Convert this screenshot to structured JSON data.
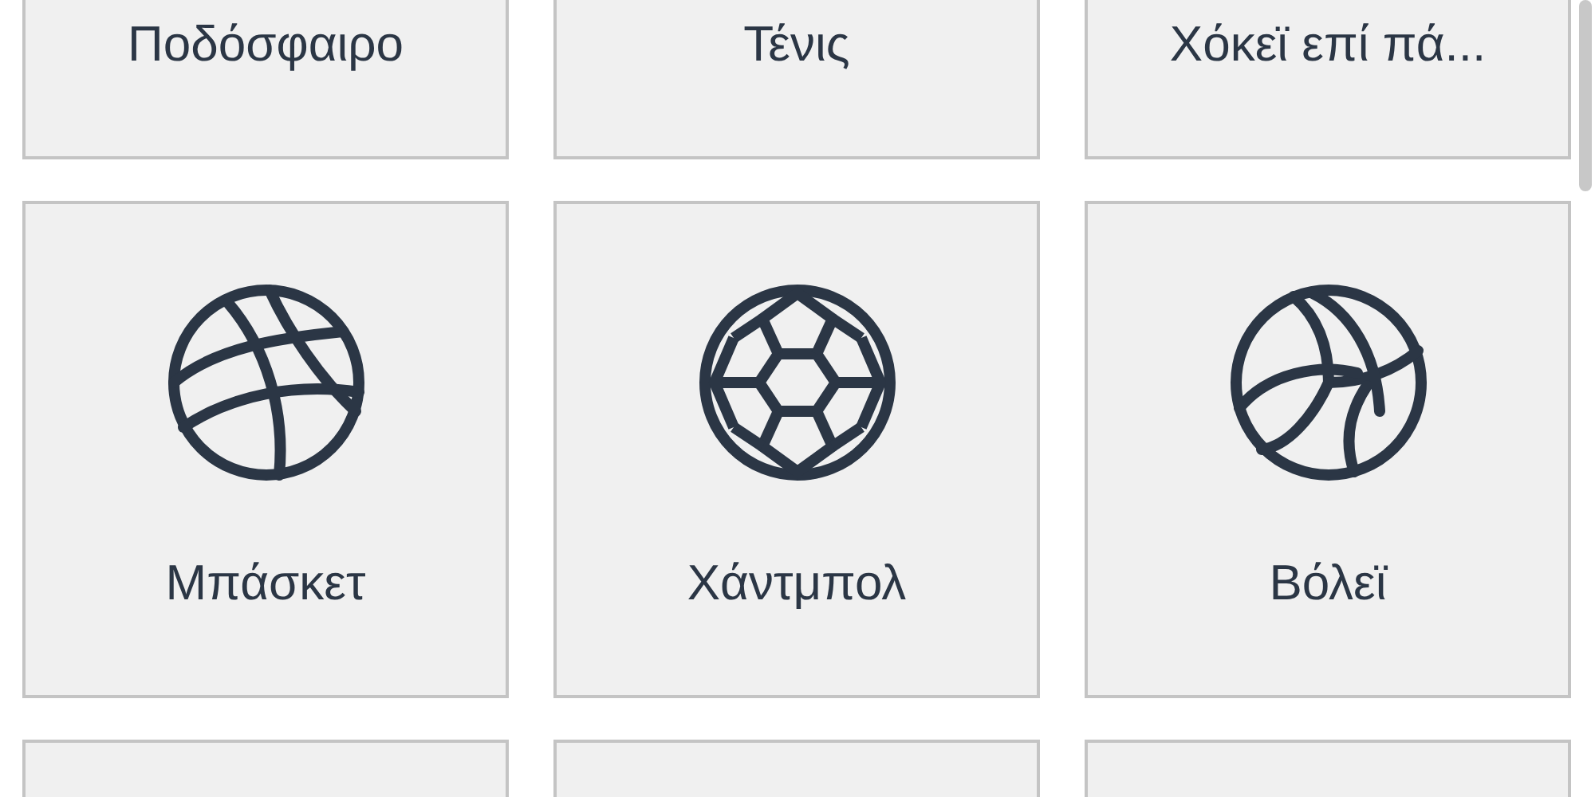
{
  "tiles": [
    {
      "label": "Ποδόσφαιρο"
    },
    {
      "label": "Τένις"
    },
    {
      "label": "Χόκεϊ επί πά..."
    },
    {
      "label": "Μπάσκετ",
      "kind": "basketball"
    },
    {
      "label": "Χάντμπολ",
      "kind": "handball"
    },
    {
      "label": "Βόλεϊ",
      "kind": "volleyball"
    },
    {
      "kind": "blank"
    },
    {
      "kind": "blank"
    },
    {
      "kind": "blank"
    }
  ]
}
